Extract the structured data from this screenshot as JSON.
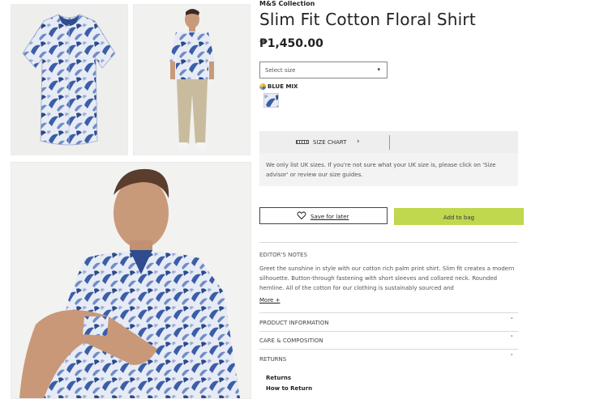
{
  "product": {
    "brand": "M&S Collection",
    "title": "Slim Fit Cotton Floral Shirt",
    "price": "₱1,450.00"
  },
  "size_select": {
    "selected": "Select size",
    "chevron": "chevron-down-icon"
  },
  "colour": {
    "name": "BLUE MIX",
    "swatch_colors": [
      "#e8ecf6",
      "#3a5ea8",
      "#9db0d8"
    ]
  },
  "size_chart": {
    "label": "SIZE CHART",
    "note": "We only list UK sizes. If you're not sure what your UK size is, please click on 'Size advisor' or review our size guides."
  },
  "actions": {
    "save_label": "Save for later",
    "add_label": "Add to bag",
    "add_color": "#bfd84e"
  },
  "editors": {
    "heading": "EDITOR'S NOTES",
    "text": "Greet the sunshine in style with our cotton rich palm print shirt. Slim fit creates a modern silhouette. Button-through fastening with short sleeves and collared neck. Rounded hemline. All of the cotton for our clothing is sustainably sourced and",
    "more": "More +"
  },
  "accordion": [
    {
      "label": "PRODUCT INFORMATION",
      "chevron": "˅"
    },
    {
      "label": "CARE & COMPOSITION",
      "chevron": "˅"
    },
    {
      "label": "RETURNS",
      "chevron": "˄"
    }
  ],
  "returns_links": [
    "Returns",
    "How to Return"
  ],
  "images": [
    {
      "alt": "shirt-flatlay"
    },
    {
      "alt": "model-full-length"
    },
    {
      "alt": "model-closeup"
    }
  ]
}
